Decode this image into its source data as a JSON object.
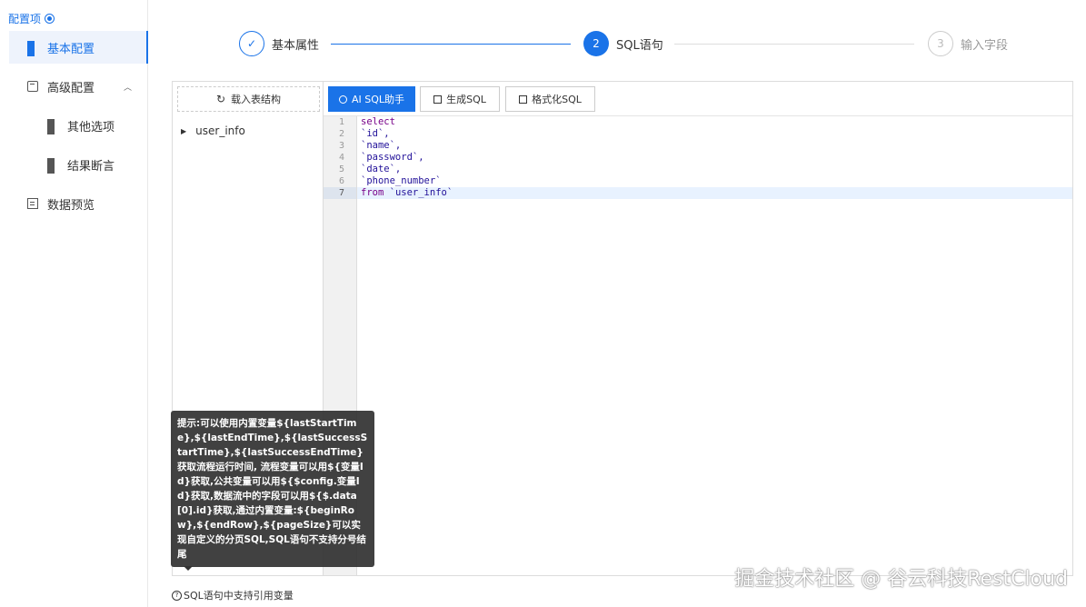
{
  "sidebar": {
    "title": "配置项",
    "items": [
      {
        "label": "基本配置",
        "icon": "grid-icon",
        "active": true
      },
      {
        "label": "高级配置",
        "icon": "cube-icon",
        "expanded": true
      },
      {
        "label": "其他选项",
        "icon": "grid-icon"
      },
      {
        "label": "结果断言",
        "icon": "grid-icon"
      },
      {
        "label": "数据预览",
        "icon": "preview-icon"
      }
    ]
  },
  "steps": [
    {
      "number": "✓",
      "label": "基本属性",
      "status": "done"
    },
    {
      "number": "2",
      "label": "SQL语句",
      "status": "current"
    },
    {
      "number": "3",
      "label": "输入字段",
      "status": "pending"
    }
  ],
  "tree": {
    "load_label": "载入表结构",
    "items": [
      "user_info"
    ]
  },
  "toolbar": {
    "ai_label": "AI SQL助手",
    "generate_label": "生成SQL",
    "format_label": "格式化SQL"
  },
  "editor": {
    "line_numbers": [
      "1",
      "2",
      "3",
      "4",
      "5",
      "6",
      "7"
    ],
    "active_line": 7,
    "lines": [
      {
        "kw": "select",
        "rest": ""
      },
      {
        "kw": "",
        "rest": "`id`,"
      },
      {
        "kw": "",
        "rest": "`name`,"
      },
      {
        "kw": "",
        "rest": "`password`,"
      },
      {
        "kw": "",
        "rest": "`date`,"
      },
      {
        "kw": "",
        "rest": "`phone_number`"
      },
      {
        "kw": "from",
        "rest": " `user_info`"
      }
    ]
  },
  "tooltip": {
    "text": "提示:可以使用内置变量${lastStartTime},${lastEndTime},${lastSuccessStartTime},${lastSuccessEndTime}获取流程运行时间, 流程变量可以用${变量Id}获取,公共变量可以用${$config.变量Id}获取,数据流中的字段可以用${$.data[0].id}获取,通过内置变量:${beginRow},${endRow},${pageSize}可以实现自定义的分页SQL,SQL语句不支持分号结尾"
  },
  "note": {
    "icon": "?",
    "text": "SQL语句中支持引用变量"
  },
  "watermark": "掘金技术社区 @ 谷云科技RestCloud",
  "colors": {
    "accent": "#1a73e8"
  }
}
